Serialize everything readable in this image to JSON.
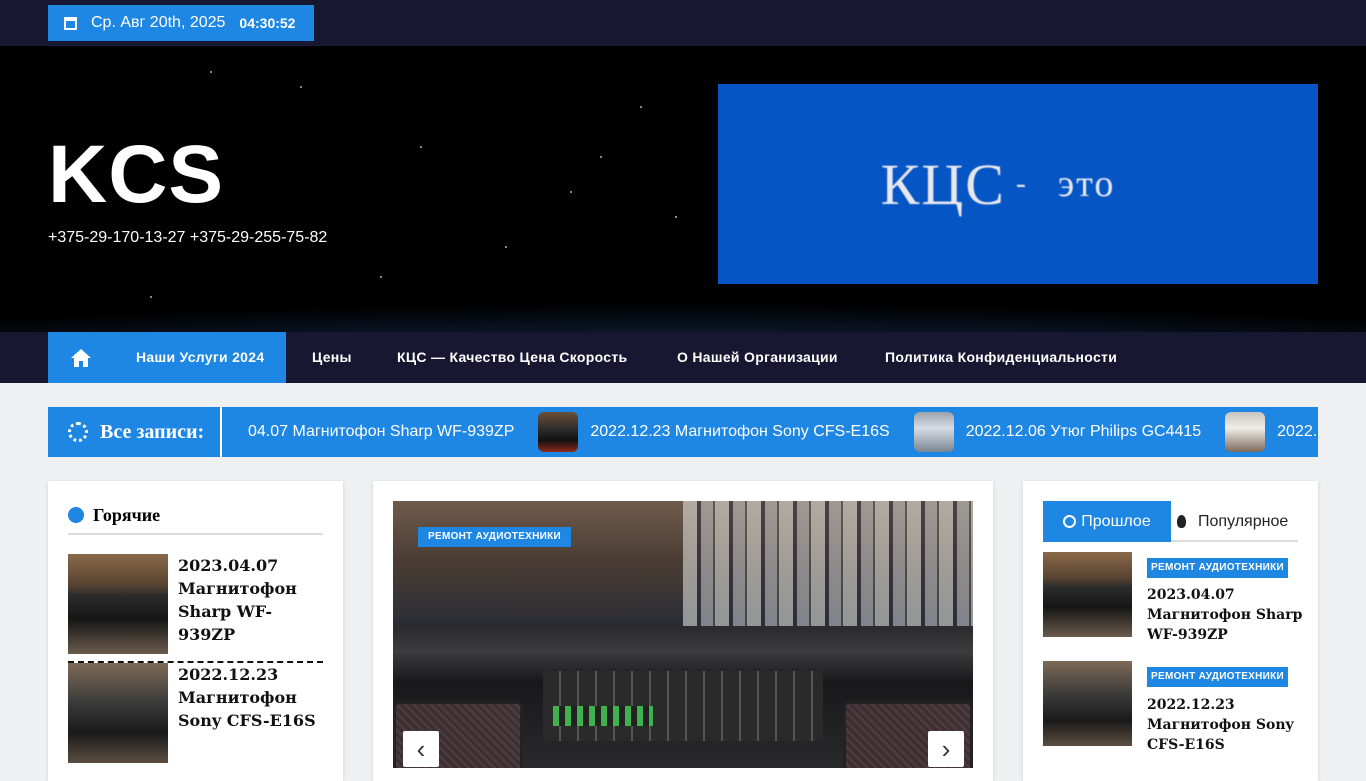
{
  "topbar": {
    "date": "Ср. Авг 20th, 2025",
    "time": "04:30:52"
  },
  "site": {
    "title": "KCS",
    "description": "+375-29-170-13-27 +375-29-255-75-82"
  },
  "banner": {
    "word1": "КЦС",
    "dash": "-",
    "word2": "это"
  },
  "nav": {
    "home_icon": "home-icon",
    "items": [
      {
        "label": "Наши Услуги 2024"
      },
      {
        "label": "Цены"
      },
      {
        "label": "КЦС — Качество Цена Скорость"
      },
      {
        "label": "О Нашей Организации"
      },
      {
        "label": "Политика Конфиденциальности"
      }
    ]
  },
  "ticker": {
    "label": "Все записи:",
    "items": [
      {
        "title": "04.07 Магнитофон Sharp WF-939ZP"
      },
      {
        "title": "2022.12.23 Магнитофон Sony CFS-E16S"
      },
      {
        "title": "2022.12.06 Утюг Philips GC4415"
      },
      {
        "title": "2022."
      }
    ]
  },
  "hot": {
    "title": "Горячие",
    "posts": [
      {
        "title": "2023.04.07 Магнитофон Sharp WF-939ZP"
      },
      {
        "title": "2022.12.23 Магнитофон Sony CFS-E16S"
      }
    ]
  },
  "slider": {
    "category": "РЕМОНТ АУДИОТЕХНИКИ",
    "prev": "‹",
    "next": "›"
  },
  "sidebar": {
    "tab_recent": "Прошлое",
    "tab_popular": "Популярное",
    "posts": [
      {
        "category": "РЕМОНТ АУДИОТЕХНИКИ",
        "title": "2023.04.07 Магнитофон Sharp WF-939ZP"
      },
      {
        "category": "РЕМОНТ АУДИОТЕХНИКИ",
        "title": "2022.12.23 Магнитофон Sony CFS-E16S"
      }
    ]
  },
  "colors": {
    "accent": "#1e86e3",
    "topbar": "#181732"
  }
}
